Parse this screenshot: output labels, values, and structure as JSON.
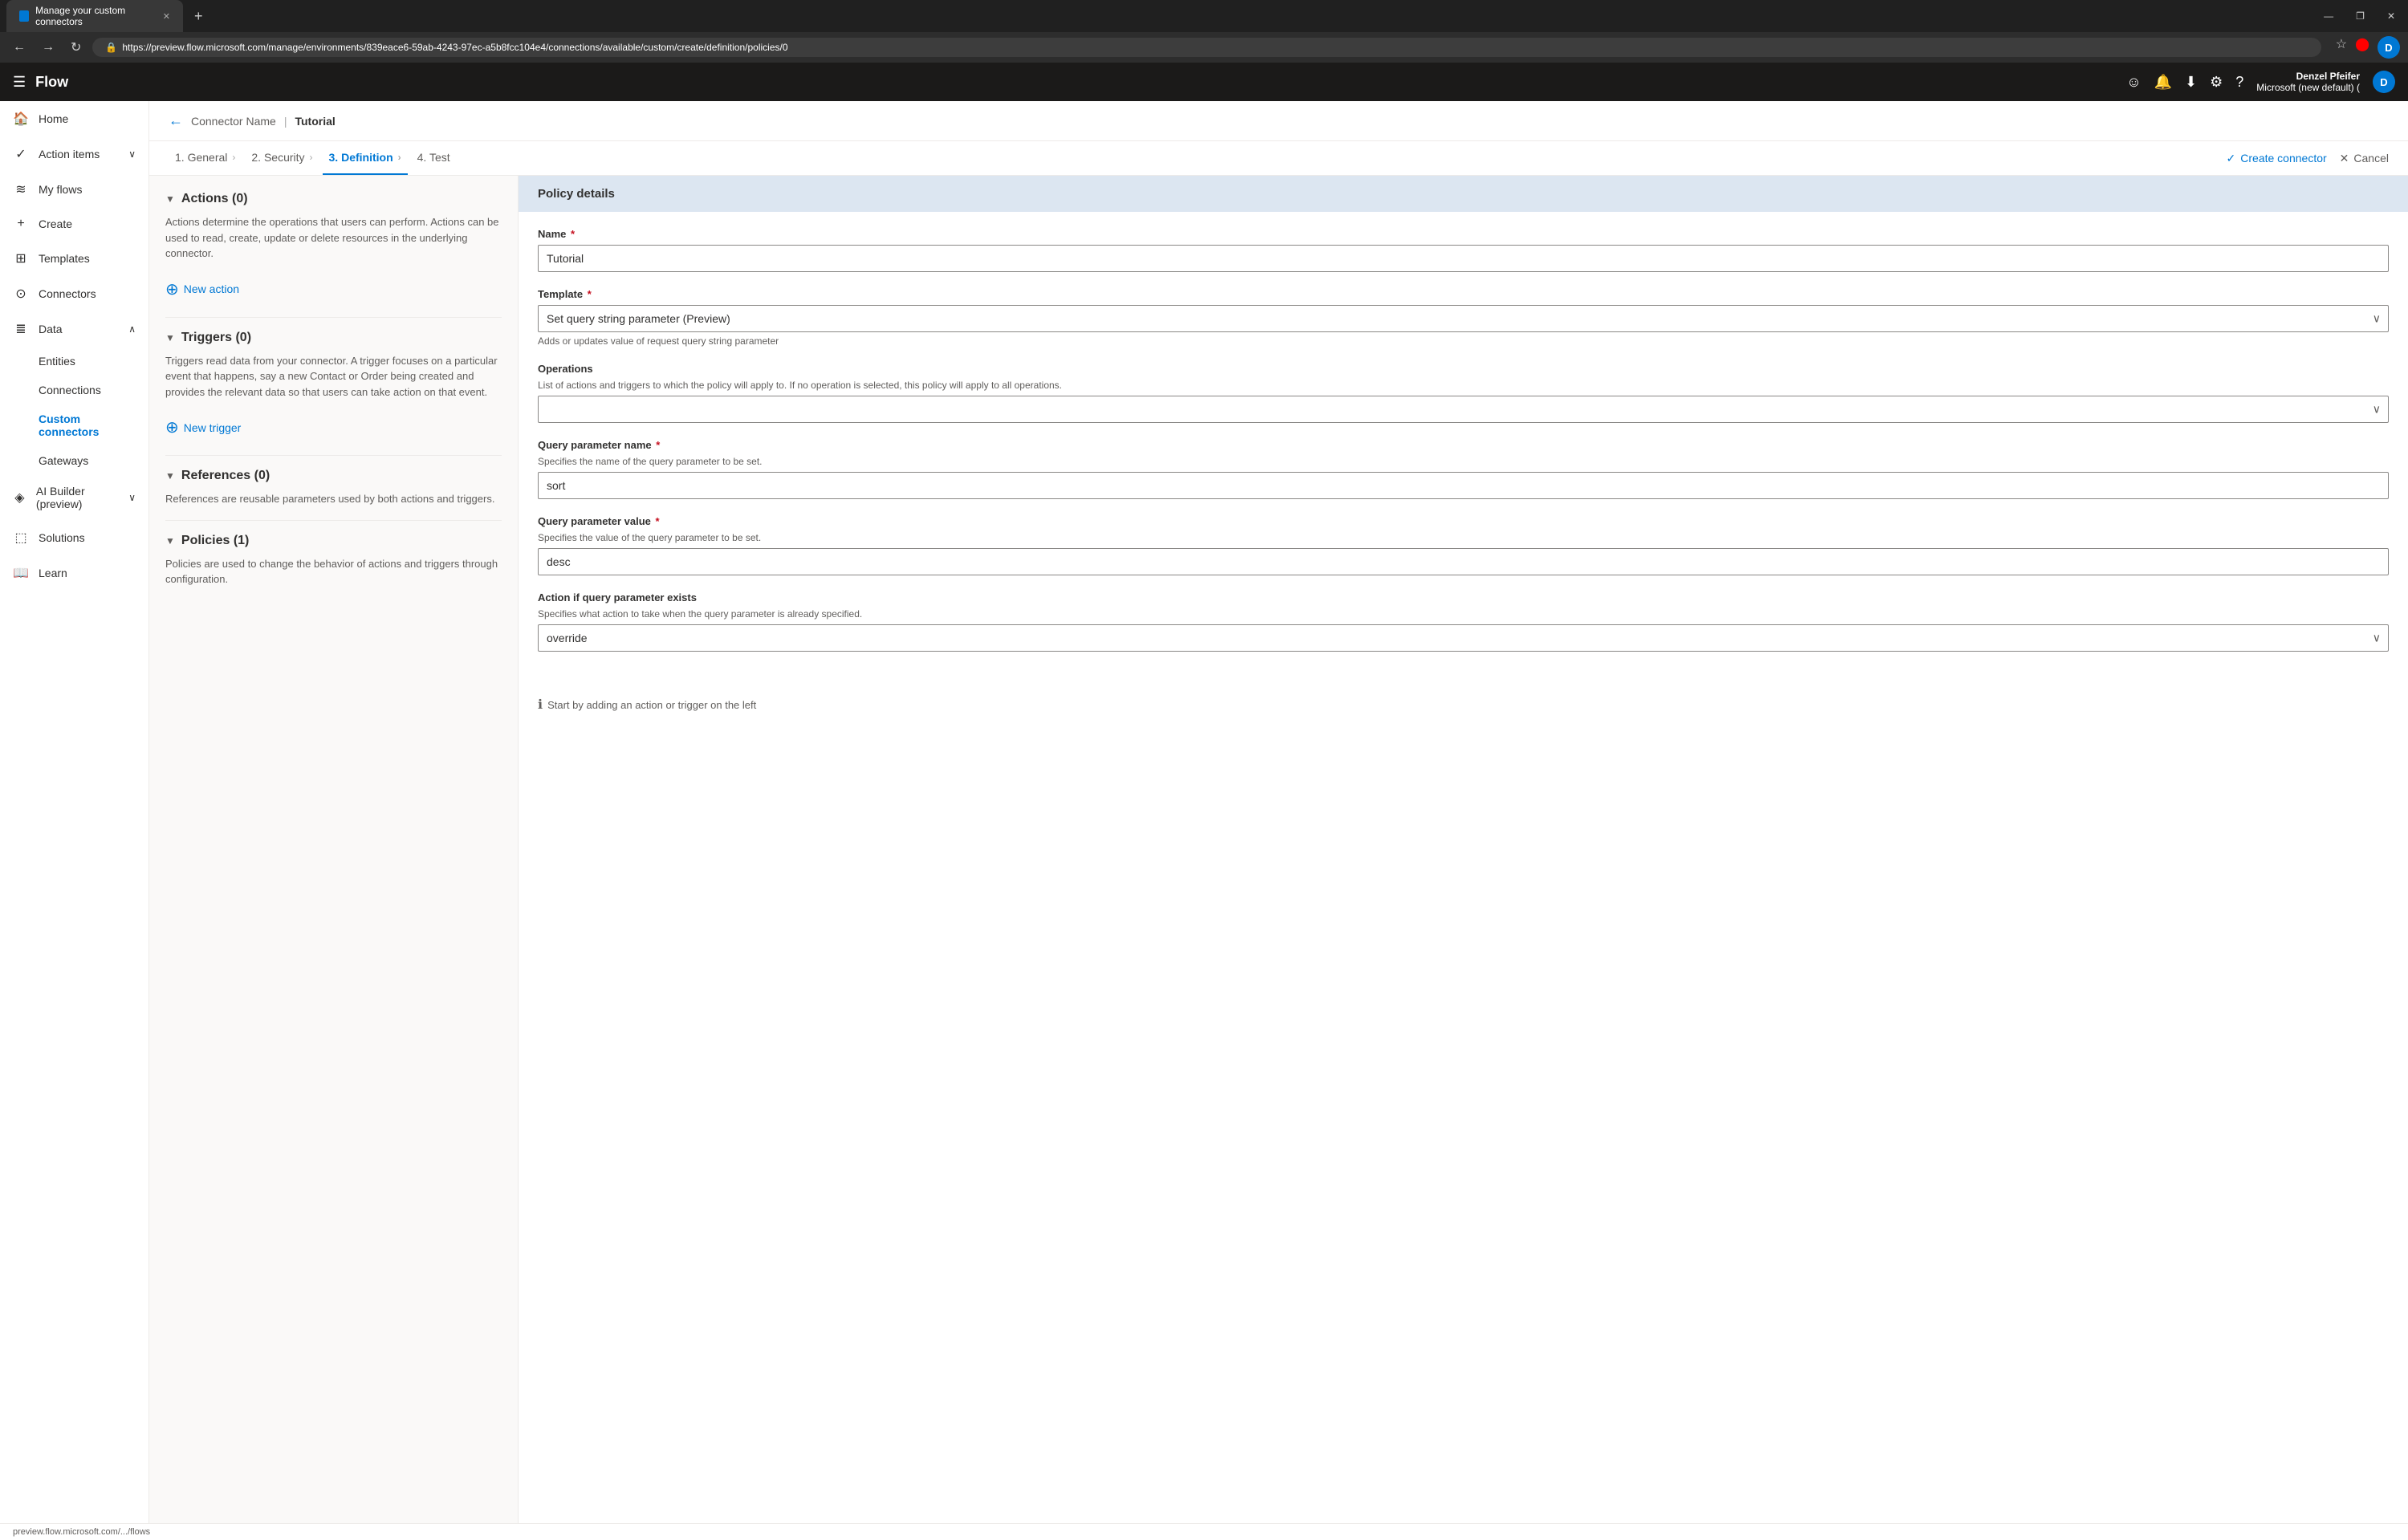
{
  "browser": {
    "tab_title": "Manage your custom connectors",
    "url": "https://preview.flow.microsoft.com/manage/environments/839eace6-59ab-4243-97ec-a5b8fcc104e4/connections/available/custom/create/definition/policies/0",
    "new_tab_label": "+",
    "win_minimize": "—",
    "win_restore": "❐",
    "win_close": "✕"
  },
  "nav_icons": {
    "emoji": "☺",
    "bell": "🔔",
    "download": "⬇",
    "settings": "⚙",
    "help": "?"
  },
  "user": {
    "name": "Denzel Pfeifer",
    "org": "Microsoft (new default) (",
    "avatar_initial": "D"
  },
  "top_nav": {
    "app_name": "Flow"
  },
  "sidebar": {
    "items": [
      {
        "id": "home",
        "label": "Home",
        "icon": "🏠"
      },
      {
        "id": "action-items",
        "label": "Action items",
        "icon": "✓",
        "has_chevron": true
      },
      {
        "id": "my-flows",
        "label": "My flows",
        "icon": "≋"
      },
      {
        "id": "create",
        "label": "Create",
        "icon": "+"
      },
      {
        "id": "templates",
        "label": "Templates",
        "icon": "⊞"
      },
      {
        "id": "connectors",
        "label": "Connectors",
        "icon": "⊙"
      },
      {
        "id": "data",
        "label": "Data",
        "icon": "≣",
        "has_chevron": true,
        "expanded": true
      },
      {
        "id": "ai-builder",
        "label": "AI Builder (preview)",
        "icon": "◈",
        "has_chevron": true
      },
      {
        "id": "solutions",
        "label": "Solutions",
        "icon": "⬚"
      },
      {
        "id": "learn",
        "label": "Learn",
        "icon": "📖"
      }
    ],
    "sub_items": [
      {
        "id": "entities",
        "label": "Entities"
      },
      {
        "id": "connections",
        "label": "Connections"
      },
      {
        "id": "custom-connectors",
        "label": "Custom connectors",
        "active": true
      },
      {
        "id": "gateways",
        "label": "Gateways"
      }
    ]
  },
  "breadcrumb": {
    "back_icon": "←",
    "parent": "Connector Name",
    "separator": ">",
    "current": "Tutorial"
  },
  "steps": [
    {
      "id": "general",
      "label": "1. General",
      "active": false
    },
    {
      "id": "security",
      "label": "2. Security",
      "active": false
    },
    {
      "id": "definition",
      "label": "3. Definition",
      "active": true
    },
    {
      "id": "test",
      "label": "4. Test",
      "active": false
    }
  ],
  "actions": {
    "create_connector": "Create connector",
    "cancel": "Cancel"
  },
  "left_panel": {
    "sections": [
      {
        "id": "actions",
        "title": "Actions (0)",
        "body": "Actions determine the operations that users can perform. Actions can be used to read, create, update or delete resources in the underlying connector.",
        "button_label": "New action",
        "chevron": "▼"
      },
      {
        "id": "triggers",
        "title": "Triggers (0)",
        "body": "Triggers read data from your connector. A trigger focuses on a particular event that happens, say a new Contact or Order being created and provides the relevant data so that users can take action on that event.",
        "button_label": "New trigger",
        "chevron": "▼"
      },
      {
        "id": "references",
        "title": "References (0)",
        "body": "References are reusable parameters used by both actions and triggers.",
        "chevron": "▼"
      },
      {
        "id": "policies",
        "title": "Policies (1)",
        "body": "Policies are used to change the behavior of actions and triggers through configuration.",
        "chevron": "▼"
      }
    ]
  },
  "right_panel": {
    "header": "Policy details",
    "form": {
      "name_label": "Name",
      "name_required": true,
      "name_value": "Tutorial",
      "template_label": "Template",
      "template_required": true,
      "template_value": "Set query string parameter (Preview)",
      "template_hint": "Adds or updates value of request query string parameter",
      "operations_label": "Operations",
      "operations_hint": "List of actions and triggers to which the policy will apply to. If no operation is selected, this policy will apply to all operations.",
      "operations_value": "",
      "query_param_name_label": "Query parameter name",
      "query_param_name_required": true,
      "query_param_name_hint": "Specifies the name of the query parameter to be set.",
      "query_param_name_value": "sort",
      "query_param_value_label": "Query parameter value",
      "query_param_value_required": true,
      "query_param_value_hint": "Specifies the value of the query parameter to be set.",
      "query_param_value_value": "desc",
      "action_exists_label": "Action if query parameter exists",
      "action_exists_hint": "Specifies what action to take when the query parameter is already specified.",
      "action_exists_value": "override"
    },
    "bottom_hint": "Start by adding an action or trigger on the left"
  },
  "status_bar": {
    "text": "preview.flow.microsoft.com/.../flows"
  }
}
